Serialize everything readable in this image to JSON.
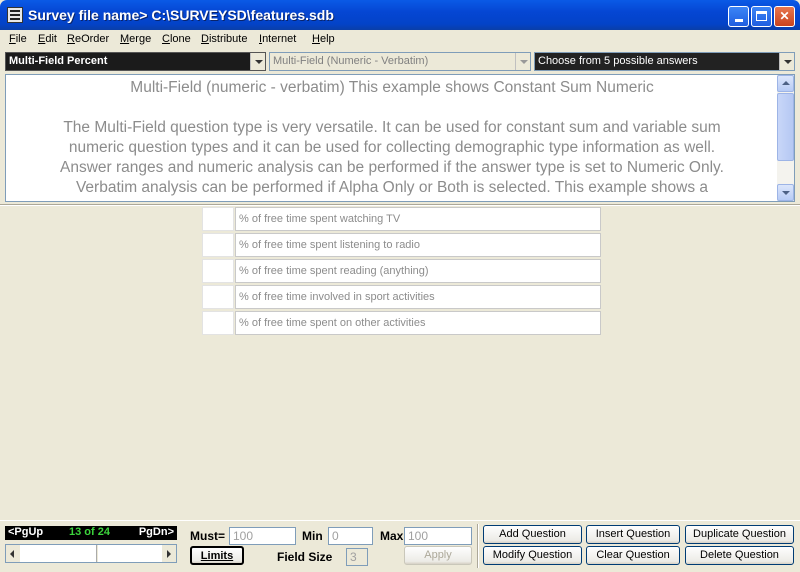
{
  "window": {
    "title": "Survey file name> C:\\SURVEYSD\\features.sdb"
  },
  "menu": [
    {
      "pre": "",
      "u": "F",
      "post": "ile"
    },
    {
      "pre": "",
      "u": "E",
      "post": "dit"
    },
    {
      "pre": "",
      "u": "R",
      "post": "eOrder"
    },
    {
      "pre": "",
      "u": "M",
      "post": "erge"
    },
    {
      "pre": "",
      "u": "C",
      "post": "lone"
    },
    {
      "pre": "",
      "u": "D",
      "post": "istribute"
    },
    {
      "pre": "",
      "u": "I",
      "post": "nternet"
    },
    {
      "pre": "",
      "u": "H",
      "post": "elp"
    }
  ],
  "combos": {
    "question_name": "Multi-Field Percent",
    "question_type": "Multi-Field (Numeric - Verbatim)",
    "answers": "Choose from 5 possible answers"
  },
  "question": {
    "heading": "Multi-Field (numeric - verbatim) This example shows Constant Sum Numeric",
    "body_lines": [
      "The Multi-Field question type is very versatile. It can be used for constant sum and variable sum",
      "numeric question types and it can be used for collecting demographic type information as well.",
      "Answer ranges and numeric analysis can be performed if the answer type is set to Numeric Only.",
      "Verbatim analysis can be performed if Alpha Only or Both is selected. This example shows a"
    ]
  },
  "fields": [
    "% of free time spent watching TV",
    "% of free time spent listening to radio",
    "% of free time spent reading (anything)",
    "% of free time involved in sport activities",
    "% of free time spent on other activities"
  ],
  "pager": {
    "pgup": "<PgUp",
    "count": "13 of  24",
    "pgdn": "PgDn>"
  },
  "limits": {
    "must_label": "Must=",
    "must_value": "100",
    "min_label": "Min",
    "min_value": "0",
    "max_label": "Max",
    "max_value": "100",
    "limits_button": "Limits",
    "field_size_label": "Field Size",
    "field_size_value": "3",
    "apply_button": "Apply"
  },
  "actions": {
    "add": "Add Question",
    "insert": "Insert Question",
    "duplicate": "Duplicate Question",
    "modify": "Modify Question",
    "clear": "Clear Question",
    "delete": "Delete Question"
  }
}
